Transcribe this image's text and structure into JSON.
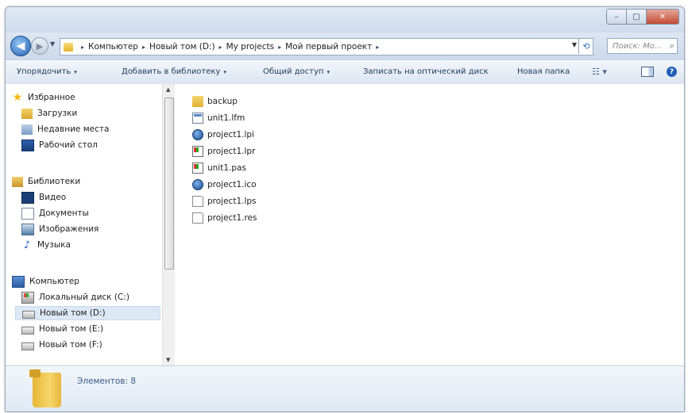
{
  "title_buttons": {
    "minimize": "–",
    "maximize": "□",
    "close": "✕"
  },
  "address": {
    "crumbs": [
      "Компьютер",
      "Новый том (D:)",
      "My projects",
      "Мой первый проект"
    ],
    "separator": "▸"
  },
  "search": {
    "placeholder": "Поиск: Мо..."
  },
  "toolbar": {
    "organize": "Упорядочить",
    "add_library": "Добавить в библиотеку",
    "share": "Общий доступ",
    "burn": "Записать на оптический диск",
    "new_folder": "Новая папка",
    "dropdown": "▾"
  },
  "sidebar": {
    "favorites": "Избранное",
    "downloads": "Загрузки",
    "recent": "Недавние места",
    "desktop": "Рабочий стол",
    "libraries": "Библиотеки",
    "video": "Видео",
    "documents": "Документы",
    "images": "Изображения",
    "music": "Музыка",
    "computer": "Компьютер",
    "drive_c": "Локальный диск (C:)",
    "drive_d": "Новый том (D:)",
    "drive_e": "Новый том (E:)",
    "drive_f": "Новый том (F:)"
  },
  "files": [
    {
      "name": "backup",
      "icon": "folder-icon"
    },
    {
      "name": "unit1.lfm",
      "icon": "form-file-icon"
    },
    {
      "name": "project1.lpi",
      "icon": "lazarus-project-icon"
    },
    {
      "name": "project1.lpr",
      "icon": "pascal-file-icon"
    },
    {
      "name": "unit1.pas",
      "icon": "pascal-file-icon"
    },
    {
      "name": "project1.ico",
      "icon": "lazarus-project-icon"
    },
    {
      "name": "project1.lps",
      "icon": "blank-file-icon"
    },
    {
      "name": "project1.res",
      "icon": "blank-file-icon"
    }
  ],
  "status": {
    "text": "Элементов: 8"
  },
  "colors": {
    "accent": "#2663b3",
    "selection": "#dde8f5"
  }
}
